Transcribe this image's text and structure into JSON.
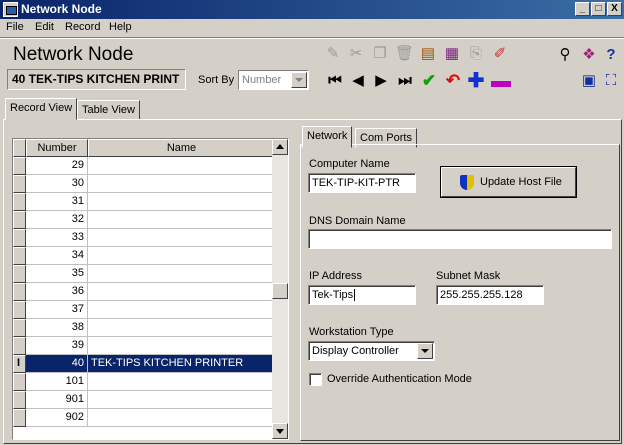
{
  "window": {
    "title": "Network Node",
    "controls": [
      "_",
      "□",
      "X"
    ]
  },
  "menu": [
    "File",
    "Edit",
    "Record",
    "Help"
  ],
  "header": {
    "title": "Network Node",
    "record_label": "40 TEK-TIPS KITCHEN PRINT",
    "sort_by_label": "Sort By",
    "sort_by_value": "Number"
  },
  "toolbar": {
    "icons_left": [
      "edit-icon",
      "cut-icon",
      "copy-icon",
      "delete-icon",
      "print-preview-icon",
      "print-icon",
      "paste-icon",
      "paint-icon"
    ],
    "nav_icons": [
      "first-record-icon",
      "previous-record-icon",
      "next-record-icon",
      "last-record-icon",
      "save-check-icon",
      "undo-icon",
      "add-icon",
      "remove-icon"
    ],
    "icons_right": [
      "find-binoculars-icon",
      "book-icon",
      "help-icon",
      "monitor-icon",
      "network-icon"
    ]
  },
  "tabs_main": [
    "Record View",
    "Table View"
  ],
  "grid": {
    "columns": [
      "Number",
      "Name"
    ],
    "rows": [
      {
        "number": "29",
        "name": ""
      },
      {
        "number": "30",
        "name": ""
      },
      {
        "number": "31",
        "name": ""
      },
      {
        "number": "32",
        "name": ""
      },
      {
        "number": "33",
        "name": ""
      },
      {
        "number": "34",
        "name": ""
      },
      {
        "number": "35",
        "name": ""
      },
      {
        "number": "36",
        "name": ""
      },
      {
        "number": "37",
        "name": ""
      },
      {
        "number": "38",
        "name": ""
      },
      {
        "number": "39",
        "name": ""
      },
      {
        "number": "40",
        "name": "TEK-TIPS KITCHEN PRINTER",
        "selected": true
      },
      {
        "number": "101",
        "name": ""
      },
      {
        "number": "901",
        "name": ""
      },
      {
        "number": "902",
        "name": ""
      }
    ]
  },
  "tabs_detail": [
    "Network",
    "Com Ports"
  ],
  "detail": {
    "computer_name_label": "Computer Name",
    "computer_name_value": "TEK-TIP-KIT-PTR",
    "update_host_button": "Update Host File",
    "dns_label": "DNS Domain Name",
    "dns_value": "",
    "ip_label": "IP Address",
    "ip_value": "Tek-Tips",
    "subnet_label": "Subnet Mask",
    "subnet_value": "255.255.255.128",
    "workstation_type_label": "Workstation Type",
    "workstation_type_value": "Display Controller",
    "override_auth_label": "Override Authentication Mode",
    "override_auth_checked": false
  },
  "colors": {
    "title_bar": "#0a246a",
    "selection": "#0a246a",
    "window_bg": "#d4d0c8"
  }
}
